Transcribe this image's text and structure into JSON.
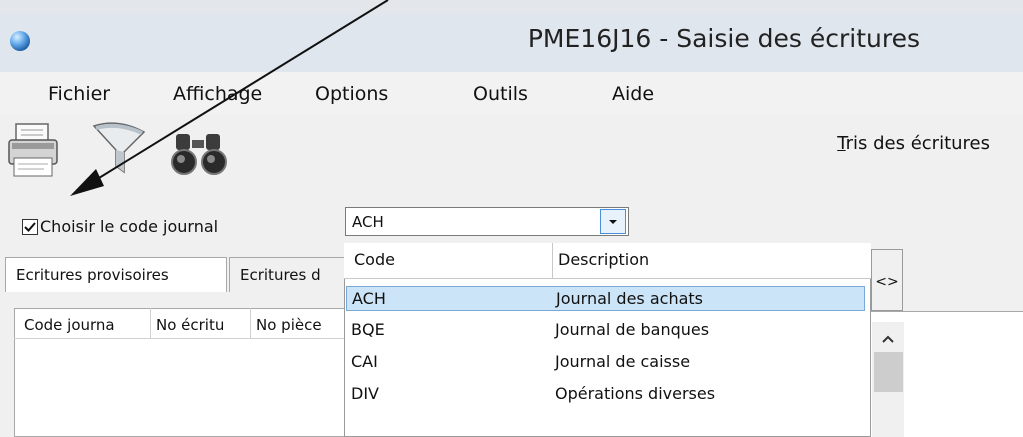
{
  "window": {
    "title": "PME16J16 - Saisie des écritures"
  },
  "menu": [
    "Fichier",
    "Affichage",
    "Options",
    "Outils",
    "Aide"
  ],
  "toolbar": {
    "sort_link_prefix": "T",
    "sort_link_rest": "ris des écritures",
    "icons": [
      "printer-icon",
      "filter-funnel-icon",
      "binoculars-icon"
    ]
  },
  "journal_filter": {
    "checkbox_label": "Choisir le code journal",
    "checked": true,
    "selected_code": "ACH"
  },
  "tabs": [
    "Ecritures provisoires",
    "Ecritures d"
  ],
  "grid": {
    "columns": [
      "Code journa",
      "No écritu",
      "No pièce"
    ]
  },
  "dropdown": {
    "headers": {
      "code": "Code",
      "description": "Description"
    },
    "rows": [
      {
        "code": "ACH",
        "description": "Journal des achats"
      },
      {
        "code": "BQE",
        "description": "Journal de banques"
      },
      {
        "code": "CAI",
        "description": "Journal de caisse"
      },
      {
        "code": "DIV",
        "description": "Opérations diverses"
      }
    ],
    "selected_index": 0
  },
  "expand_button_label": "<>",
  "colors": {
    "selection": "#cce4f7",
    "titlebar": "#dfe6ee",
    "focus_border": "#4a90d9"
  }
}
